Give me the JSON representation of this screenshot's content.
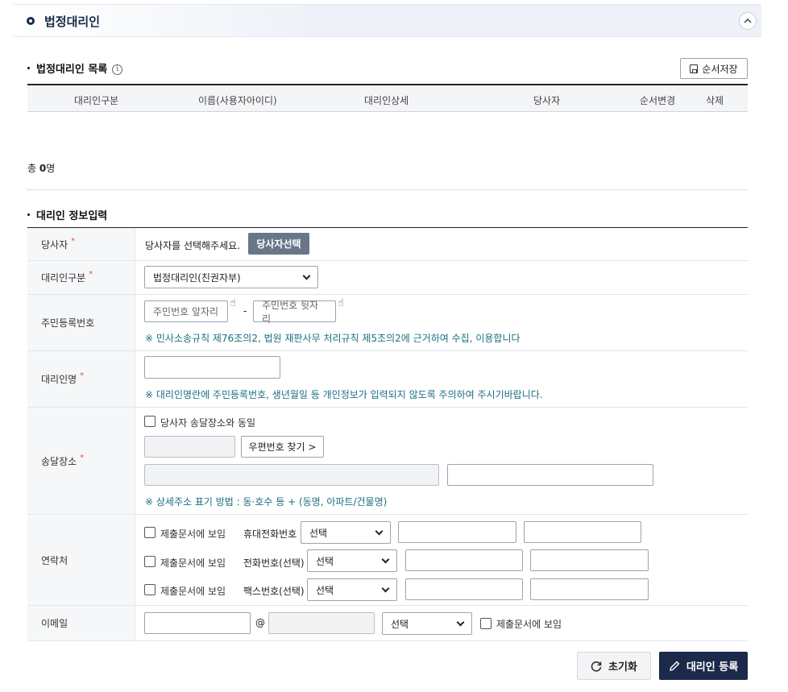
{
  "section": {
    "title": "법정대리인",
    "collapse_icon": "chevron-up-icon"
  },
  "list": {
    "title": "법정대리인 목록",
    "info_icon": "i",
    "order_save_label": "순서저장",
    "columns": [
      "대리인구분",
      "이름(사용자아이디)",
      "대리인상세",
      "당사자",
      "순서변경",
      "삭제"
    ],
    "total_prefix": "총 ",
    "total_count": "0",
    "total_suffix": "명"
  },
  "form": {
    "title": "대리인 정보입력",
    "party": {
      "label": "당사자",
      "required": "*",
      "text": "당사자를 선택해주세요.",
      "button": "당사자선택"
    },
    "agent_type": {
      "label": "대리인구분",
      "required": "*",
      "selected": "법정대리인(친권자부)"
    },
    "resident_no": {
      "label": "주민등록번호",
      "front_placeholder": "주민번호 앞자리",
      "back_placeholder": "주민번호 뒷자리",
      "separator": "-",
      "note": "※ 민사소송규칙 제76조의2, 법원 재판사무 처리규칙 제5조의2에 근거하여 수집, 이용합니다"
    },
    "agent_name": {
      "label": "대리인명",
      "required": "*",
      "note": "※ 대리인명란에 주민등록번호, 생년월일 등 개인정보가 입력되지 않도록 주의하여 주시기바랍니다."
    },
    "delivery": {
      "label": "송달장소",
      "required": "*",
      "same_as_party": "당사자 송달장소와 동일",
      "zip_button": "우편번호 찾기 >",
      "note": "※ 상세주소 표기 방법 : 동·호수 등 + (동명, 아파트/건물명)"
    },
    "contact": {
      "label": "연락처",
      "rows": [
        {
          "show_label": "제출문서에 보임",
          "type": "휴대전화번호",
          "select": "선택"
        },
        {
          "show_label": "제출문서에 보임",
          "type": "전화번호(선택)",
          "select": "선택"
        },
        {
          "show_label": "제출문서에 보임",
          "type": "팩스번호(선택)",
          "select": "선택"
        }
      ]
    },
    "email": {
      "label": "이메일",
      "at": "@",
      "select": "선택",
      "show_label": "제출문서에 보임"
    }
  },
  "actions": {
    "reset_label": "초기화",
    "register_label": "대리인 등록"
  }
}
